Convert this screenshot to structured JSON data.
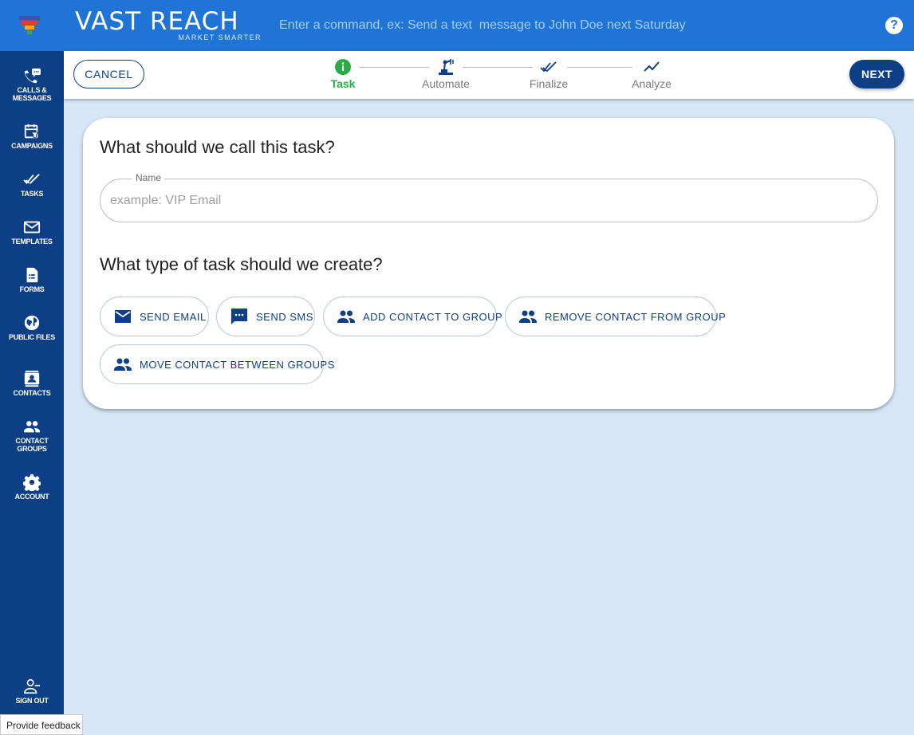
{
  "header": {
    "logo_text": "VAST REACH",
    "logo_tagline": "MARKET SMARTER",
    "command_placeholder": "Enter a command, ex: Send a text  message to John Doe next Saturday",
    "help_label": "?"
  },
  "sidebar": {
    "items": [
      {
        "label": "CALLS & MESSAGES",
        "icon": "phone-chat-icon"
      },
      {
        "label": "CAMPAIGNS",
        "icon": "calendar-icon"
      },
      {
        "label": "TASKS",
        "icon": "double-check-icon"
      },
      {
        "label": "TEMPLATES",
        "icon": "mail-icon"
      },
      {
        "label": "FORMS",
        "icon": "document-icon"
      },
      {
        "label": "PUBLIC FILES",
        "icon": "globe-icon"
      },
      {
        "label": "CONTACTS",
        "icon": "contact-card-icon"
      },
      {
        "label": "CONTACT GROUPS",
        "icon": "people-icon"
      },
      {
        "label": "ACCOUNT",
        "icon": "gear-icon"
      }
    ],
    "sign_out": "SIGN OUT",
    "feedback": "Provide feedback"
  },
  "stepper": {
    "cancel_label": "CANCEL",
    "next_label": "NEXT",
    "steps": [
      {
        "label": "Task",
        "icon": "info-icon",
        "active": true
      },
      {
        "label": "Automate",
        "icon": "robot-arm-icon",
        "active": false
      },
      {
        "label": "Finalize",
        "icon": "double-check-icon",
        "active": false
      },
      {
        "label": "Analyze",
        "icon": "trend-line-icon",
        "active": false
      }
    ]
  },
  "form": {
    "name_question": "What should we call this task?",
    "name_label": "Name",
    "name_placeholder": "example: VIP Email",
    "name_value": "",
    "type_question": "What type of task should we create?",
    "task_types": [
      {
        "label": "SEND EMAIL",
        "icon": "mail-icon"
      },
      {
        "label": "SEND SMS",
        "icon": "sms-icon"
      },
      {
        "label": "ADD CONTACT TO GROUP",
        "icon": "people-icon"
      },
      {
        "label": "REMOVE CONTACT FROM GROUP",
        "icon": "people-icon"
      },
      {
        "label": "MOVE CONTACT BETWEEN GROUPS",
        "icon": "people-icon"
      }
    ]
  },
  "colors": {
    "header_blue": "#1f74d6",
    "sidebar_navy": "#0c3f86",
    "page_bg": "#d6e6f6",
    "active_step_green": "#2eaa46"
  }
}
